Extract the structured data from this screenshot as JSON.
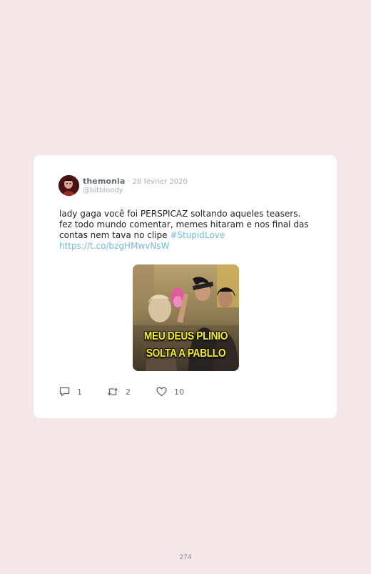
{
  "tweet": {
    "display_name": "themonia",
    "separator": "·",
    "date": "28 février 2020",
    "handle": "@bitbloody",
    "text_lines": [
      "lady gaga você foi PERSPICAZ soltando aqueles teasers.",
      "fez todo mundo comentar, memes hitaram e nos final das",
      "contas nem tava no clipe "
    ],
    "hashtag": "#StupidLove",
    "link": "https://t.co/bzgHMwvNsW",
    "media": {
      "caption_line_1": "MEU DEUS PLINIO",
      "caption_line_2": "SOLTA A PABLLO"
    },
    "actions": {
      "reply_icon": "reply-icon",
      "reply_count": "1",
      "retweet_icon": "retweet-icon",
      "retweet_count": "2",
      "like_icon": "heart-icon",
      "like_count": "10"
    }
  },
  "page": {
    "number": "274"
  },
  "colors": {
    "background": "#f5e6e9",
    "card": "#ffffff",
    "link": "#73b9de",
    "meme_text": "#f4ee1f"
  }
}
